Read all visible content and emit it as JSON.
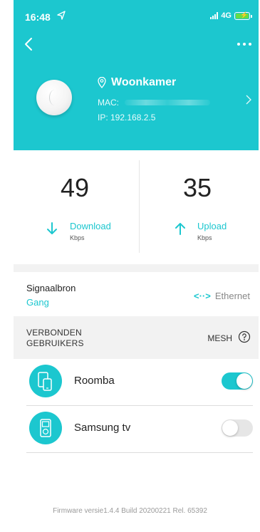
{
  "status_bar": {
    "time": "16:48",
    "network": "4G",
    "icons": [
      "location-arrow-icon",
      "signal-bars-icon",
      "battery-charging-icon"
    ]
  },
  "header": {
    "back_icon": "chevron-left-icon",
    "more_icon": "more-dots-icon",
    "device": {
      "location_icon": "location-pin-icon",
      "name": "Woonkamer",
      "mac_label": "MAC:",
      "ip": "IP: 192.168.2.5",
      "chevron_icon": "chevron-right-icon"
    },
    "color": "#1cc7cf"
  },
  "speeds": {
    "download": {
      "value": "49",
      "label": "Download",
      "unit": "Kbps",
      "icon": "arrow-down-icon"
    },
    "upload": {
      "value": "35",
      "label": "Upload",
      "unit": "Kbps",
      "icon": "arrow-up-icon"
    }
  },
  "signal_source": {
    "title": "Signaalbron",
    "value": "Gang",
    "connection_icon": "ethernet-arrows-icon",
    "connection_icon_glyph": "<··>",
    "connection": "Ethernet"
  },
  "connected_users": {
    "title_line1": "VERBONDEN",
    "title_line2": "GEBRUIKERS",
    "mesh_label": "MESH",
    "help_icon": "help-circle-icon"
  },
  "clients": [
    {
      "name": "Roomba",
      "icon": "devices-icon",
      "enabled": true
    },
    {
      "name": "Samsung tv",
      "icon": "ipod-icon",
      "enabled": false
    }
  ],
  "footer": {
    "firmware": "Firmware versie1.4.4 Build 20200221 Rel. 65392"
  },
  "colors": {
    "accent": "#1cc7cf",
    "toggle_off": "#e6e6e6",
    "section_bg": "#f2f2f2"
  }
}
